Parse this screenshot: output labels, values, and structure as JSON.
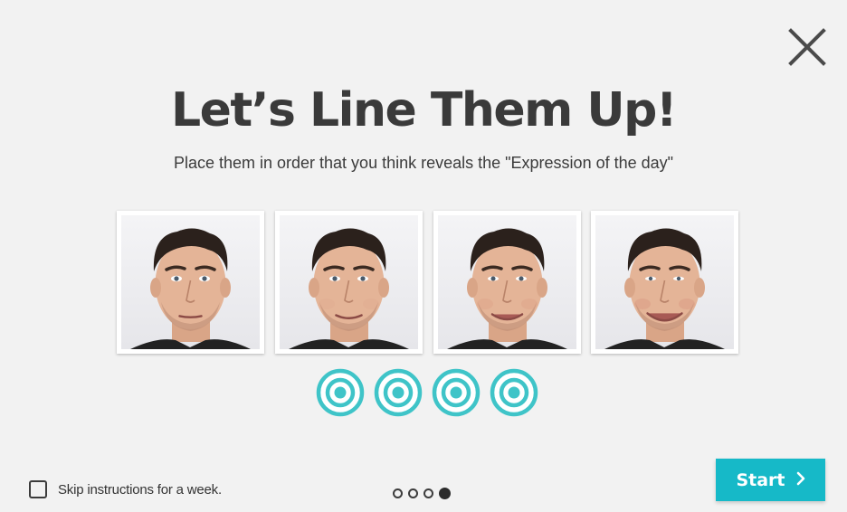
{
  "dialog": {
    "title": "Let’s Line Them Up!",
    "subtitle": "Place them in order that you think reveals the \"Expression of the day\"",
    "close_icon": "close-icon"
  },
  "photos": [
    {
      "expression": "neutral",
      "smile_level": 0.0
    },
    {
      "expression": "slight",
      "smile_level": 0.3
    },
    {
      "expression": "smile",
      "smile_level": 0.65
    },
    {
      "expression": "big-smile",
      "smile_level": 1.0
    }
  ],
  "targets": {
    "count": 4,
    "icon": "target-ring-icon",
    "color": "#3fc4c8"
  },
  "skip": {
    "label": "Skip instructions for a week.",
    "checked": false
  },
  "pagination": {
    "total": 4,
    "current": 4
  },
  "start_button": {
    "label": "Start",
    "icon": "chevron-right-icon"
  },
  "colors": {
    "accent": "#16b9c8",
    "background": "#f2f2f2",
    "text": "#3a3a3a"
  }
}
